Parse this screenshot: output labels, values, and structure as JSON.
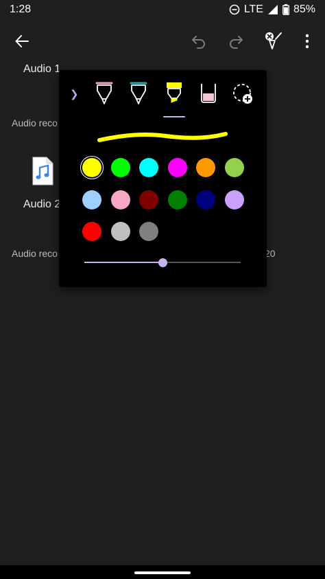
{
  "status_bar": {
    "time": "1:28",
    "network": "LTE",
    "battery": "85%",
    "icons": [
      "do-not-disturb-icon",
      "signal-icon",
      "battery-icon"
    ]
  },
  "toolbar": {
    "icons": [
      "back-arrow-icon",
      "undo-icon",
      "redo-icon",
      "pen-cancel-icon",
      "more-vert-icon"
    ]
  },
  "content": {
    "item1_title": "Audio 1",
    "item1_subtitle": "Audio reco",
    "item2_title": "Audio 2",
    "item2_subtitle": "Audio reco",
    "item2_subtitle_suffix": "20",
    "file_icon": "audio-file-icon"
  },
  "pen_panel": {
    "tools": [
      {
        "name": "pen-pink",
        "color": "#f4a4c4"
      },
      {
        "name": "pen-teal",
        "color": "#2aa8a8"
      },
      {
        "name": "highlighter-yellow",
        "color": "#ffff00"
      },
      {
        "name": "highlighter-pink",
        "color": "#f0c6dc"
      },
      {
        "name": "add-pen",
        "color": "#ffffff"
      }
    ],
    "selected_tool": "highlighter-yellow",
    "preview_stroke_color": "#ffff00",
    "colors": [
      "#ffff00",
      "#00ff00",
      "#00ffff",
      "#ff00ff",
      "#ff9900",
      "#92d050",
      "#9fcfff",
      "#f7a6c8",
      "#7f0000",
      "#007f00",
      "#00007f",
      "#c9a0ff",
      "#ff0000",
      "#bfbfbf",
      "#808080"
    ],
    "selected_color": "#ffff00",
    "thickness_fraction": 0.5
  },
  "nav_bar": {
    "handle": "home-handle"
  }
}
